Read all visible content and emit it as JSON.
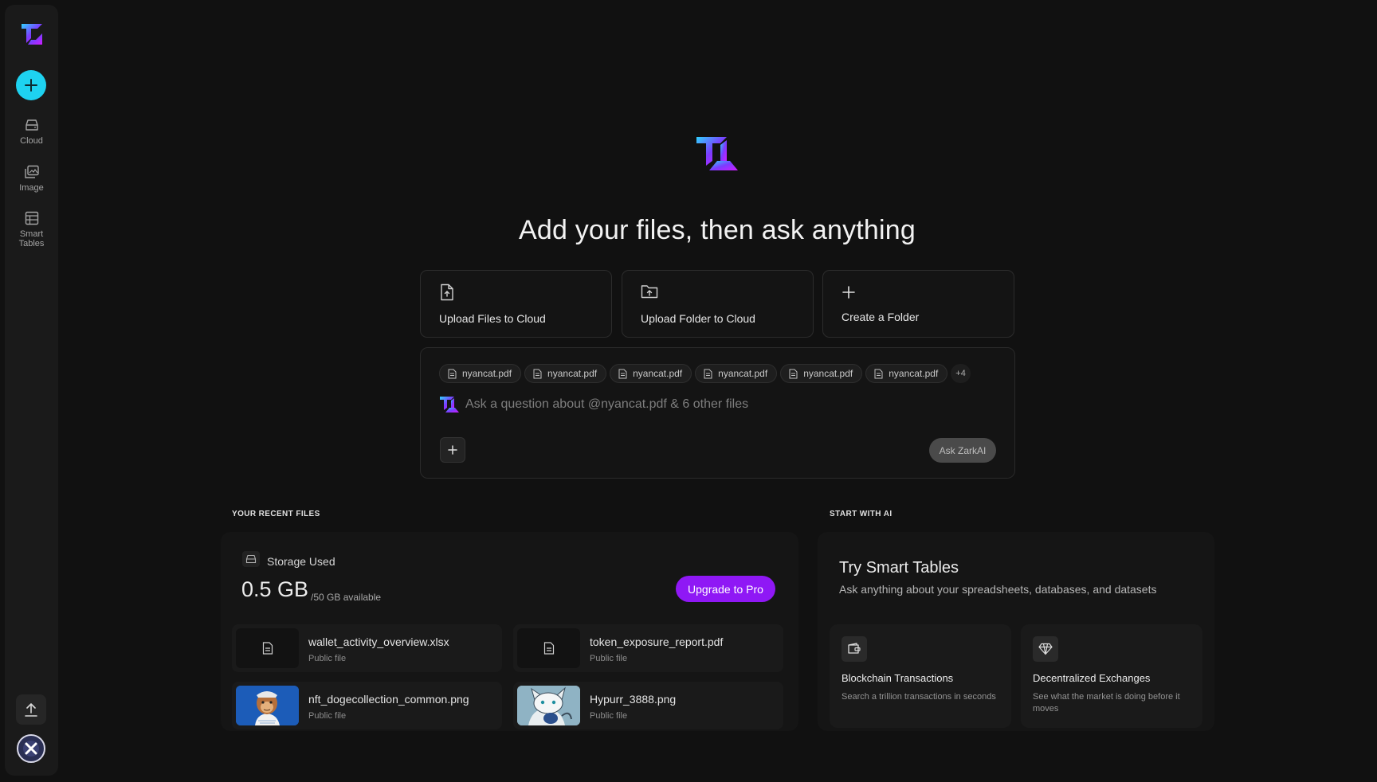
{
  "sidebar": {
    "items": [
      {
        "label": "Cloud",
        "icon": "drive-icon"
      },
      {
        "label": "Image",
        "icon": "image-icon"
      },
      {
        "label": "Smart Tables",
        "icon": "table-icon"
      }
    ]
  },
  "hero": {
    "title": "Add your files, then ask anything"
  },
  "actions": [
    {
      "label": "Upload Files to Cloud",
      "icon": "file-upload-icon"
    },
    {
      "label": "Upload Folder to Cloud",
      "icon": "folder-upload-icon"
    },
    {
      "label": "Create a Folder",
      "icon": "plus-icon"
    }
  ],
  "ask": {
    "chips": [
      "nyancat.pdf",
      "nyancat.pdf",
      "nyancat.pdf",
      "nyancat.pdf",
      "nyancat.pdf",
      "nyancat.pdf"
    ],
    "more": "+4",
    "placeholder": "Ask a question about @nyancat.pdf & 6 other files",
    "submit_label": "Ask ZarkAI"
  },
  "recent": {
    "section_label": "YOUR RECENT FILES",
    "storage_label": "Storage Used",
    "storage_used": "0.5 GB",
    "storage_available": "/50 GB available",
    "upgrade_label": "Upgrade to Pro",
    "files": [
      {
        "name": "wallet_activity_overview.xlsx",
        "visibility": "Public file"
      },
      {
        "name": "token_exposure_report.pdf",
        "visibility": "Public file"
      },
      {
        "name": "nft_dogecollection_common.png",
        "visibility": "Public file"
      },
      {
        "name": "Hypurr_3888.png",
        "visibility": "Public file"
      }
    ]
  },
  "start_ai": {
    "section_label": "START WITH AI",
    "title": "Try Smart Tables",
    "subtitle": "Ask anything about your spreadsheets, databases, and datasets",
    "cards": [
      {
        "title": "Blockchain Transactions",
        "desc": "Search a trillion transactions in seconds",
        "icon": "wallet-icon"
      },
      {
        "title": "Decentralized Exchanges",
        "desc": "See what the market is doing before it moves",
        "icon": "diamond-icon"
      }
    ]
  },
  "colors": {
    "accent_cyan": "#1ed2f0",
    "accent_purple": "#8f18f5",
    "background": "#111111"
  }
}
